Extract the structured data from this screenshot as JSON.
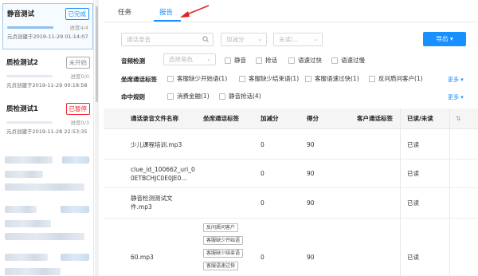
{
  "sidebar": {
    "tasks": [
      {
        "name": "静音测试",
        "status": "已完成",
        "progress_text": "进度4/4",
        "progress": 1.0,
        "created": "元贞创建于2019-11-29 01:14:07"
      },
      {
        "name": "质检测试2",
        "status": "未开始",
        "progress_text": "进度0/0",
        "progress": 0.0,
        "created": "元贞创建于2019-11-29 00:18:58"
      },
      {
        "name": "质检测试1",
        "status": "已暂停",
        "progress_text": "进度0/3",
        "progress": 0.0,
        "created": "元贞创建于2019-11-28 22:53:35"
      }
    ]
  },
  "tabs": {
    "task": "任务",
    "report": "报告"
  },
  "filters": {
    "search_placeholder": "通话录音",
    "score_placeholder": "加减分",
    "read_placeholder": "未读/...",
    "export_label": "导出"
  },
  "silence_row": {
    "label": "音频检测",
    "role_placeholder": "选择角色",
    "options": [
      "静音",
      "抢话",
      "语速过快",
      "语速过慢"
    ]
  },
  "seat_row": {
    "label": "坐席通话标签",
    "options": [
      "客服缺少开始语(1)",
      "客服缺少结束语(1)",
      "客服语速过快(1)",
      "反问质问客户(1)"
    ],
    "more": "更多"
  },
  "hit_row": {
    "label": "命中规则",
    "options": [
      "消费金融(1)",
      "静音抢话(4)"
    ],
    "more": "更多"
  },
  "table": {
    "headers": [
      "通话录音文件名称",
      "坐席通话标签",
      "加减分",
      "得分",
      "客户通话标签",
      "已读/未读"
    ],
    "rows": [
      {
        "file": "少儿课程培训.mp3",
        "tags": [],
        "score_delta": "0",
        "score": "90",
        "read": "已读"
      },
      {
        "file": "clue_id_100662_uri_0\n0ETBCHJC0E0JE0...",
        "tags": [],
        "score_delta": "0",
        "score": "90",
        "read": "已读"
      },
      {
        "file": "静音检测测试文\n件.mp3",
        "tags": [],
        "score_delta": "0",
        "score": "90",
        "read": "已读"
      },
      {
        "file": "60.mp3",
        "tags": [
          "反问质问客户",
          "客服缺少开始语",
          "客服缺少结束语",
          "客服语速过快"
        ],
        "score_delta": "0",
        "score": "90",
        "read": "已读"
      }
    ]
  },
  "colors": {
    "accent": "#1890ff",
    "arrow": "#e02020",
    "paused": "#f5222d"
  }
}
